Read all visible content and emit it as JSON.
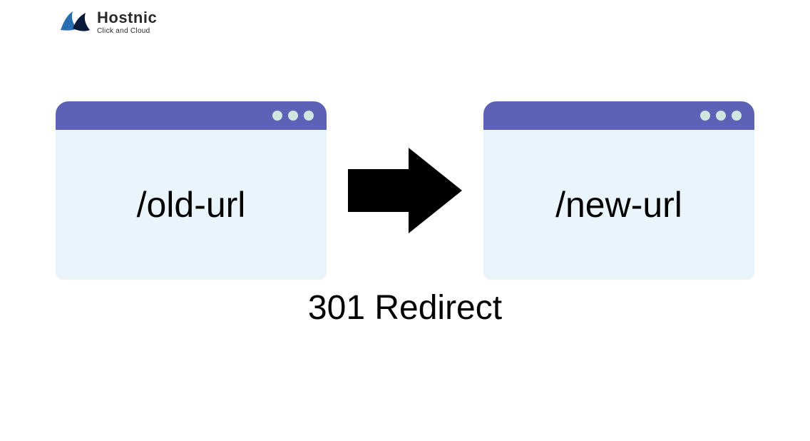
{
  "logo": {
    "name": "Hostnic",
    "tagline": "Click and Cloud"
  },
  "diagram": {
    "left_window": {
      "url": "/old-url"
    },
    "right_window": {
      "url": "/new-url"
    },
    "caption": "301 Redirect"
  },
  "colors": {
    "titlebar": "#5d62b6",
    "window_bg": "#eaf4fb",
    "dot": "#cfe6e0",
    "arrow": "#000000"
  }
}
